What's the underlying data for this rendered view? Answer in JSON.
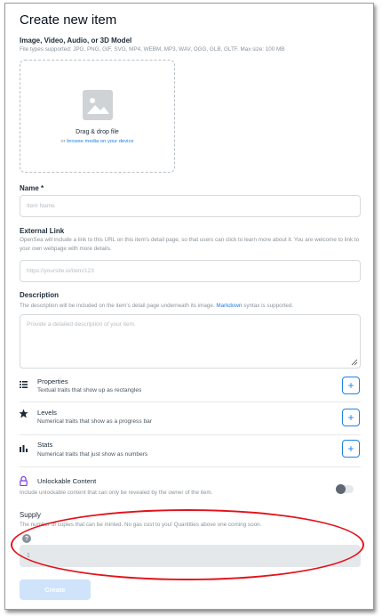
{
  "page": {
    "title": "Create new item"
  },
  "media": {
    "label": "Image, Video, Audio, or 3D Model",
    "sub": "File types supported: JPG, PNG, GIF, SVG, MP4, WEBM, MP3, WAV, OGG, GLB, GLTF. Max size: 100 MB",
    "drag_title": "Drag & drop file",
    "drag_prefix": "or",
    "drag_link": "browse media on your device",
    "icon": "image-placeholder-icon"
  },
  "name": {
    "label": "Name *",
    "placeholder": "Item Name"
  },
  "external_link": {
    "label": "External Link",
    "sub": "OpenSea will include a link to this URL on this item's detail page, so that users can click to learn more about it. You are welcome to link to your own webpage with more details.",
    "placeholder": "https://yoursite.io/item/123"
  },
  "description": {
    "label": "Description",
    "sub_before": "The description will be included on the item's detail page underneath its image.",
    "sub_link": "Markdown",
    "sub_after": "syntax is supported.",
    "placeholder": "Provide a detailed description of your item."
  },
  "properties": {
    "title": "Properties",
    "sub": "Textual traits that show up as rectangles",
    "icon": "list-icon",
    "action": "+"
  },
  "levels": {
    "title": "Levels",
    "sub": "Numerical traits that show as a progress bar",
    "icon": "star-icon",
    "action": "+"
  },
  "stats": {
    "title": "Stats",
    "sub": "Numerical traits that just show as numbers",
    "icon": "bar-chart-icon",
    "action": "+"
  },
  "unlockable": {
    "title": "Unlockable Content",
    "sub": "Include unlockable content that can only be revealed by the owner of the item.",
    "icon": "lock-icon",
    "enabled": false
  },
  "supply": {
    "label": "Supply",
    "sub": "The number of copies that can be minted. No gas cost to you! Quantities above one coming soon.",
    "help": "?",
    "value": "1"
  },
  "create": {
    "label": "Create"
  },
  "colors": {
    "accent": "#2081e2",
    "annotation": "#e3121b",
    "disabled_button": "#cfe3fa"
  }
}
